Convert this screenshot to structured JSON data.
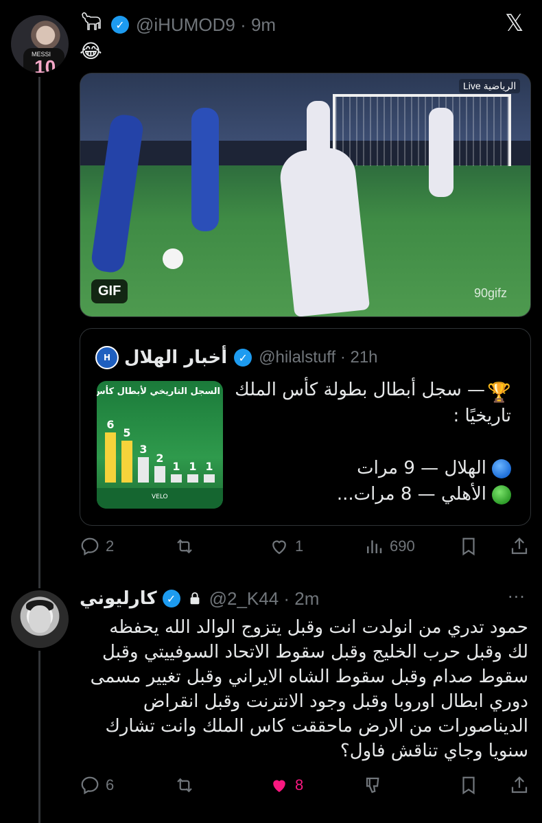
{
  "tweet1": {
    "handle": "@iHUMOD9 · 9m",
    "text_emoji": "😂",
    "gif": {
      "badge": "GIF",
      "watermark": "90gifz",
      "tv_logo": "Live الرياضية"
    },
    "quote": {
      "name": "أخبار الهلال",
      "handle": "@hilalstuff · 21h",
      "text_lines": [
        "— سجل أبطال بطولة كأس الملك",
        "تاريخيًا :",
        "",
        "الهلال — 9 مرات",
        "الأهلي — 8 مرات..."
      ],
      "thumbnail": {
        "title": "السجل التاريخي لأبطال كأس الملك",
        "bar_values": [
          6,
          5,
          3,
          2,
          1,
          1,
          1
        ],
        "footer": "VELO"
      }
    },
    "actions": {
      "reply_count": "2",
      "retweet_count": "",
      "like_count": "1",
      "views_count": "690"
    }
  },
  "tweet2": {
    "name": "كارليوني",
    "handle": "@2_K44 · 2m",
    "more": "···",
    "text_lines": [
      "حمود تدري من انولدت انت وقبل يتزوج الوالد الله يحفظه",
      "لك وقبل حرب الخليج وقبل سقوط الاتحاد السوفييتي وقبل",
      "سقوط صدام وقبل سقوط الشاه الايراني وقبل تغيير مسمى",
      "دوري ابطال اوروبا وقبل وجود الانترنت وقبل انقراض",
      "الديناصورات من الارض ماحققت كاس الملك وانت تشارك",
      "سنويا وجاي تناقش فاول؟"
    ],
    "actions": {
      "reply_count": "6",
      "retweet_count": "",
      "like_count": "8"
    }
  },
  "colors": {
    "background": "#000000",
    "text": "#e7e9ea",
    "muted": "#71767b",
    "verified": "#1d9bf0",
    "like_active": "#f91880"
  }
}
